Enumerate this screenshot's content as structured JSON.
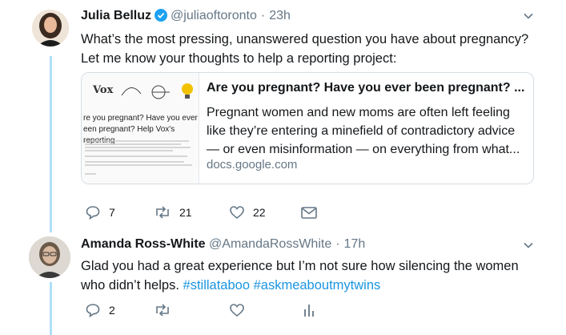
{
  "tweets": [
    {
      "name": "Julia Belluz",
      "handle": "@juliaoftoronto",
      "sep": "·",
      "time": "23h",
      "text": "What’s the most pressing, unanswered question you have about pregnancy? Let me know your thoughts to help a reporting project:",
      "card": {
        "title": "Are you pregnant? Have you ever been pregnant? ...",
        "description": "Pregnant women and new moms are often left feeling like they’re entering a minefield of contradictory advice — or even misinformation — on everything from what...",
        "domain": "docs.google.com",
        "thumb_logo": "Vox",
        "thumb_heading": "re you pregnant? Have you ever een pregnant? Help Vox's reporting"
      },
      "actions": {
        "reply": "7",
        "retweet": "21",
        "like": "22"
      }
    },
    {
      "name": "Amanda Ross-White",
      "handle": "@AmandaRossWhite",
      "sep": "·",
      "time": "17h",
      "text": "Glad you had a great experience but I’m not sure how silencing the women who didn’t helps.",
      "hashtags": [
        "#stillataboo",
        "#askmeaboutmytwins"
      ],
      "actions": {
        "reply": "2"
      }
    }
  ],
  "colors": {
    "accent": "#1b95e0",
    "muted": "#657786",
    "thread": "#aee0fa"
  },
  "icons": [
    "verified-badge-icon",
    "chevron-down-icon",
    "reply-icon",
    "retweet-icon",
    "like-icon",
    "direct-message-icon",
    "analytics-icon"
  ]
}
